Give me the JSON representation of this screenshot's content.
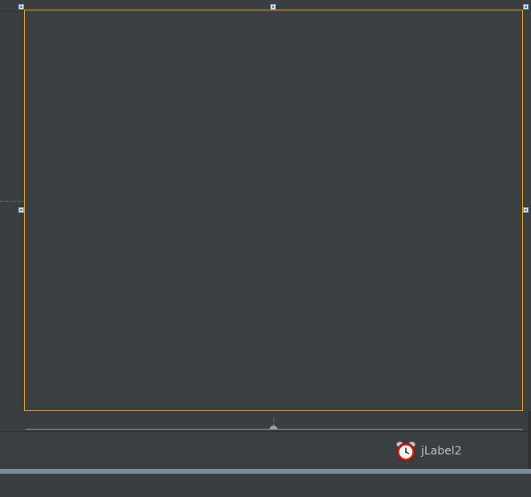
{
  "form_designer": {
    "selected_panel": {
      "border_color": "#e3a21a",
      "background_color": "#3c3f41"
    },
    "component_tray": {
      "items": [
        {
          "label": "jLabel2",
          "icon": "alarm-clock-icon"
        }
      ]
    }
  }
}
